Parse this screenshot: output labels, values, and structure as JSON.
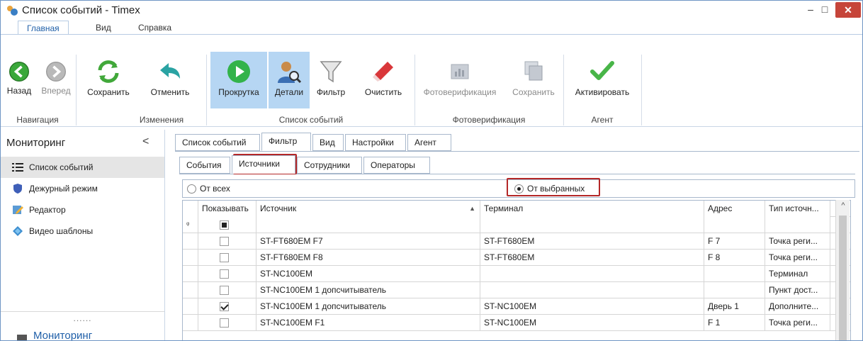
{
  "window": {
    "title": "Список событий - Timex",
    "min": "–",
    "max": "□",
    "close": "✕"
  },
  "ribbon_tabs": [
    "Главная",
    "Вид",
    "Справка"
  ],
  "ribbon": {
    "buttons": {
      "back": "Назад",
      "forward": "Вперед",
      "save": "Сохранить",
      "cancel": "Отменить",
      "scroll": "Прокрутка",
      "details": "Детали",
      "filter": "Фильтр",
      "clear": "Очистить",
      "photoverify": "Фотоверификация",
      "photo_save": "Сохранить",
      "activate": "Активировать"
    },
    "groups": {
      "navigation": "Навигация",
      "changes": "Изменения",
      "event_list": "Список событий",
      "photoverification": "Фотоверификация",
      "agent": "Агент"
    }
  },
  "sidebar": {
    "title": "Мониторинг",
    "collapse": "<",
    "items": [
      "Список событий",
      "Дежурный режим",
      "Редактор",
      "Видео шаблоны"
    ],
    "dots": "......",
    "footer": "Мониторинг"
  },
  "main_tabs": [
    "Список событий",
    "Фильтр",
    "Вид",
    "Настройки",
    "Агент"
  ],
  "sub_tabs": [
    "События",
    "Источники",
    "Сотрудники",
    "Операторы"
  ],
  "filter": {
    "from_all": "От всех",
    "from_selected": "От выбранных"
  },
  "grid": {
    "columns": [
      "Показывать",
      "Источник",
      "Терминал",
      "Адрес",
      "Тип источн..."
    ],
    "sort_indicator": "▲",
    "filter_row_icon": "ᵠ",
    "rows": [
      {
        "show": false,
        "source": "ST-FT680EM F7",
        "terminal": "ST-FT680EM",
        "address": "F 7",
        "type": "Точка реги..."
      },
      {
        "show": false,
        "source": "ST-FT680EM F8",
        "terminal": "ST-FT680EM",
        "address": "F 8",
        "type": "Точка реги..."
      },
      {
        "show": false,
        "source": "ST-NC100EM",
        "terminal": "",
        "address": "",
        "type": "Терминал"
      },
      {
        "show": false,
        "source": "ST-NC100EM 1 допсчитыватель",
        "terminal": "",
        "address": "",
        "type": "Пункт дост..."
      },
      {
        "show": true,
        "source": "ST-NC100EM 1 допсчитыватель",
        "terminal": "ST-NC100EM",
        "address": "Дверь 1",
        "type": "Дополните..."
      },
      {
        "show": false,
        "source": "ST-NC100EM F1",
        "terminal": "ST-NC100EM",
        "address": "F 1",
        "type": "Точка реги..."
      }
    ]
  }
}
